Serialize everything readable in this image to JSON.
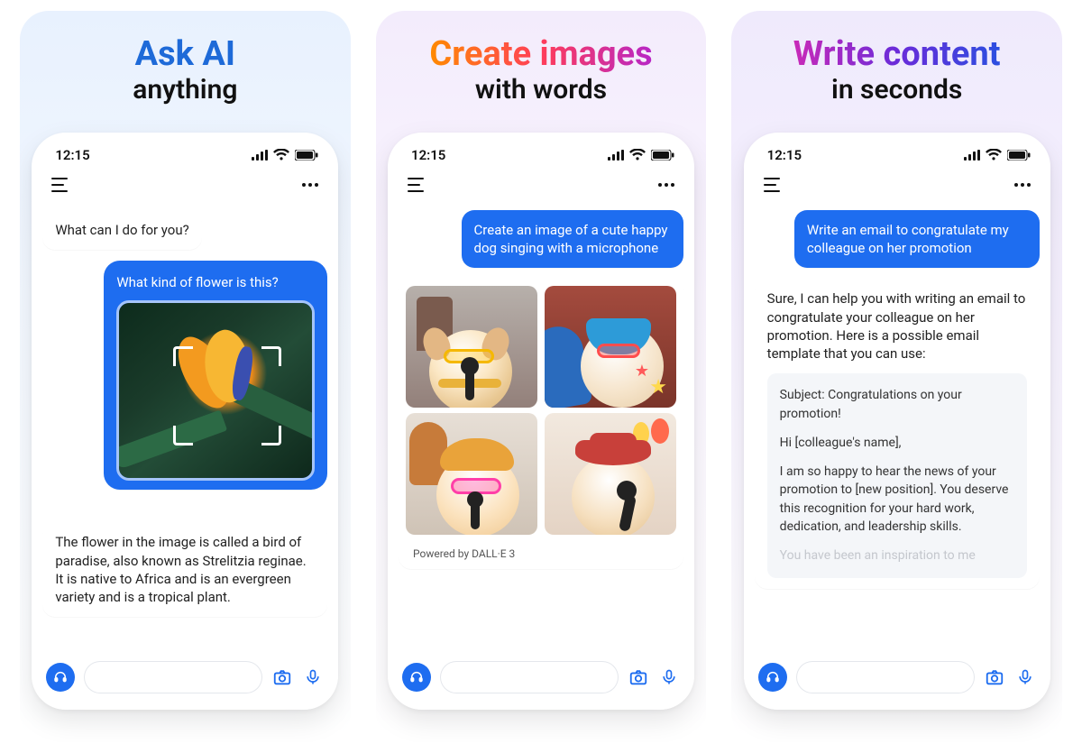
{
  "panels": [
    {
      "headline_big": "Ask AI",
      "headline_sub": "anything",
      "status_time": "12:15",
      "ai_greeting": "What can I do for you?",
      "user_question": "What kind of flower is this?",
      "ai_answer": "The flower in the image is called a bird of paradise, also known as Strelitzia reginae. It is native to Africa and is an evergreen variety and is a tropical plant."
    },
    {
      "headline_big": "Create images",
      "headline_sub": "with words",
      "status_time": "12:15",
      "user_prompt": "Create an image of a cute happy dog singing with a microphone",
      "caption": "Powered by DALL·E 3"
    },
    {
      "headline_big": "Write content",
      "headline_sub": "in seconds",
      "status_time": "12:15",
      "user_prompt": "Write an email to congratulate my colleague on her promotion",
      "ai_intro": "Sure, I can help you with writing an email to congratulate your colleague on her promotion. Here is a possible email template that you can use:",
      "email_subject": "Subject: Congratulations on your promotion!",
      "email_greeting": "Hi [colleague's name],",
      "email_body": "I am so happy to hear the news of your promotion to [new position]. You deserve this recognition for your hard work, dedication, and leadership skills.",
      "email_fade": "You have been an inspiration to me"
    }
  ],
  "icons": {
    "menu": "menu-icon",
    "more": "more-icon",
    "headset": "headset-icon",
    "camera": "camera-icon",
    "mic": "microphone-icon",
    "signal": "cellular-signal-icon",
    "wifi": "wifi-icon",
    "battery": "battery-icon"
  },
  "colors": {
    "accent": "#1e6df0"
  }
}
